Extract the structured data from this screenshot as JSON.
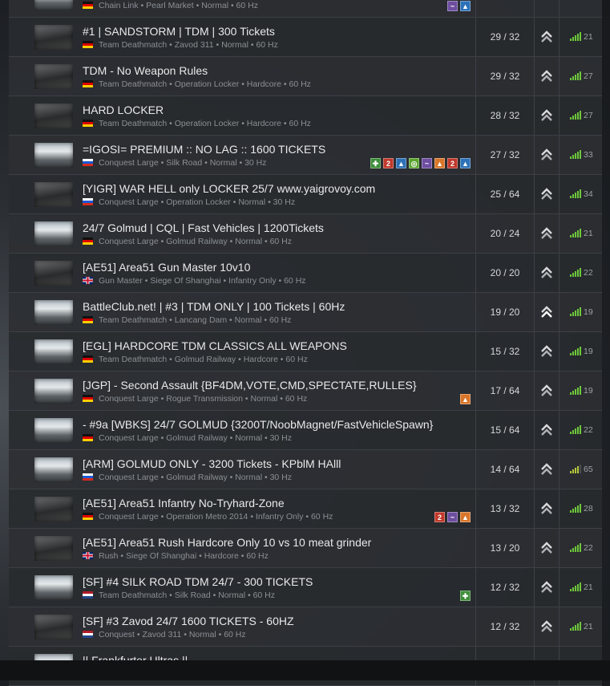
{
  "servers": [
    {
      "name": "",
      "mode": "Chain Link",
      "map": "Pearl Market",
      "preset": "Normal",
      "tick": "60 Hz",
      "flag": "de",
      "players": "",
      "ping": "",
      "badges": [
        "purple",
        "blue"
      ],
      "thumb": "sky"
    },
    {
      "name": "#1 | SANDSTORM | TDM | 300 Tickets",
      "mode": "Team Deathmatch",
      "map": "Zavod 311",
      "preset": "Normal",
      "tick": "60 Hz",
      "flag": "de",
      "players": "29 / 32",
      "ping": "21",
      "badges": [],
      "thumb": "dark"
    },
    {
      "name": "TDM - No Weapon Rules",
      "mode": "Team Deathmatch",
      "map": "Operation Locker",
      "preset": "Hardcore",
      "tick": "60 Hz",
      "flag": "de",
      "players": "29 / 32",
      "ping": "27",
      "badges": [],
      "thumb": "dark"
    },
    {
      "name": "HARD LOCKER",
      "mode": "Team Deathmatch",
      "map": "Operation Locker",
      "preset": "Hardcore",
      "tick": "60 Hz",
      "flag": "de",
      "players": "28 / 32",
      "ping": "27",
      "badges": [],
      "thumb": "dark"
    },
    {
      "name": "=IGOSI= PREMIUM :: NO LAG :: 1600 TICKETS",
      "mode": "Conquest Large",
      "map": "Silk Road",
      "preset": "Normal",
      "tick": "30 Hz",
      "flag": "ru",
      "players": "27 / 32",
      "ping": "33",
      "badges": [
        "green",
        "red",
        "blue",
        "lime",
        "purple",
        "orange",
        "red",
        "blue"
      ],
      "thumb": "sky"
    },
    {
      "name": "[YIGR] WAR HELL only LOCKER 25/7 www.yaigrovoy.com",
      "mode": "Conquest Large",
      "map": "Operation Locker",
      "preset": "Normal",
      "tick": "30 Hz",
      "flag": "ru",
      "players": "25 / 64",
      "ping": "34",
      "badges": [],
      "thumb": "dark"
    },
    {
      "name": "24/7 Golmud | CQL | Fast Vehicles | 1200Tickets",
      "mode": "Conquest Large",
      "map": "Golmud Railway",
      "preset": "Normal",
      "tick": "60 Hz",
      "flag": "de",
      "players": "20 / 24",
      "ping": "21",
      "badges": [],
      "thumb": "sky"
    },
    {
      "name": "[AE51] Area51 Gun Master 10v10",
      "mode": "Gun Master",
      "map": "Siege Of Shanghai",
      "preset": "Infantry Only",
      "tick": "60 Hz",
      "flag": "gb",
      "players": "20 / 20",
      "ping": "22",
      "badges": [],
      "thumb": "dark"
    },
    {
      "name": "BattleClub.net! | #3 | TDM ONLY | 100 Tickets | 60Hz",
      "mode": "Team Deathmatch",
      "map": "Lancang Dam",
      "preset": "Normal",
      "tick": "60 Hz",
      "flag": "de",
      "players": "19 / 20",
      "ping": "19",
      "badges": [],
      "thumb": "sky",
      "rank_double": true
    },
    {
      "name": "[EGL] HARDCORE TDM CLASSICS ALL WEAPONS",
      "mode": "Team Deathmatch",
      "map": "Golmud Railway",
      "preset": "Hardcore",
      "tick": "60 Hz",
      "flag": "de",
      "players": "15 / 32",
      "ping": "19",
      "badges": [],
      "thumb": "sky"
    },
    {
      "name": "[JGP] - Second Assault {BF4DM,VOTE,CMD,SPECTATE,RULLES}",
      "mode": "Conquest Large",
      "map": "Rogue Transmission",
      "preset": "Normal",
      "tick": "60 Hz",
      "flag": "de",
      "players": "17 / 64",
      "ping": "19",
      "badges": [
        "orange"
      ],
      "thumb": "sky"
    },
    {
      "name": "- #9a [WBKS] 24/7 GOLMUD {3200T/NoobMagnet/FastVehicleSpawn}",
      "mode": "Conquest Large",
      "map": "Golmud Railway",
      "preset": "Normal",
      "tick": "30 Hz",
      "flag": "de",
      "players": "15 / 64",
      "ping": "22",
      "badges": [],
      "thumb": "sky"
    },
    {
      "name": "[ARM] GOLMUD ONLY - 3200 Tickets - KPblM HAlll",
      "mode": "Conquest Large",
      "map": "Golmud Railway",
      "preset": "Normal",
      "tick": "30 Hz",
      "flag": "ru",
      "players": "14 / 64",
      "ping": "65",
      "badges": [],
      "thumb": "sky",
      "ping_yellow": true
    },
    {
      "name": "[AE51] Area51 Infantry No-Tryhard-Zone",
      "mode": "Conquest Large",
      "map": "Operation Metro 2014",
      "preset": "Infantry Only",
      "tick": "60 Hz",
      "flag": "de",
      "players": "13 / 32",
      "ping": "28",
      "badges": [
        "red",
        "purple",
        "orange"
      ],
      "thumb": "dark"
    },
    {
      "name": "[AE51] Area51 Rush Hardcore Only 10 vs 10 meat grinder",
      "mode": "Rush",
      "map": "Siege Of Shanghai",
      "preset": "Hardcore",
      "tick": "60 Hz",
      "flag": "gb",
      "players": "13 / 20",
      "ping": "22",
      "badges": [],
      "thumb": "dark"
    },
    {
      "name": "[SF] #4 SILK ROAD TDM 24/7 - 300 TICKETS",
      "mode": "Team Deathmatch",
      "map": "Silk Road",
      "preset": "Normal",
      "tick": "60 Hz",
      "flag": "nl",
      "players": "12 / 32",
      "ping": "21",
      "badges": [
        "green"
      ],
      "thumb": "sky"
    },
    {
      "name": "[SF] #3 Zavod 24/7 1600 TICKETS - 60HZ",
      "mode": "Conquest",
      "map": "Zavod 311",
      "preset": "Normal",
      "tick": "60 Hz",
      "flag": "nl",
      "players": "12 / 32",
      "ping": "21",
      "badges": [],
      "thumb": "dark"
    },
    {
      "name": "|| Frankfurter Ultras ||",
      "mode": "",
      "map": "",
      "preset": "",
      "tick": "",
      "flag": "",
      "players": "",
      "ping": "",
      "badges": [],
      "thumb": "sky"
    }
  ],
  "separator": " • ",
  "colors": {
    "ping_good": "#6ec83b",
    "ping_fair": "#b7c93a",
    "row_border": "#3c4046"
  }
}
